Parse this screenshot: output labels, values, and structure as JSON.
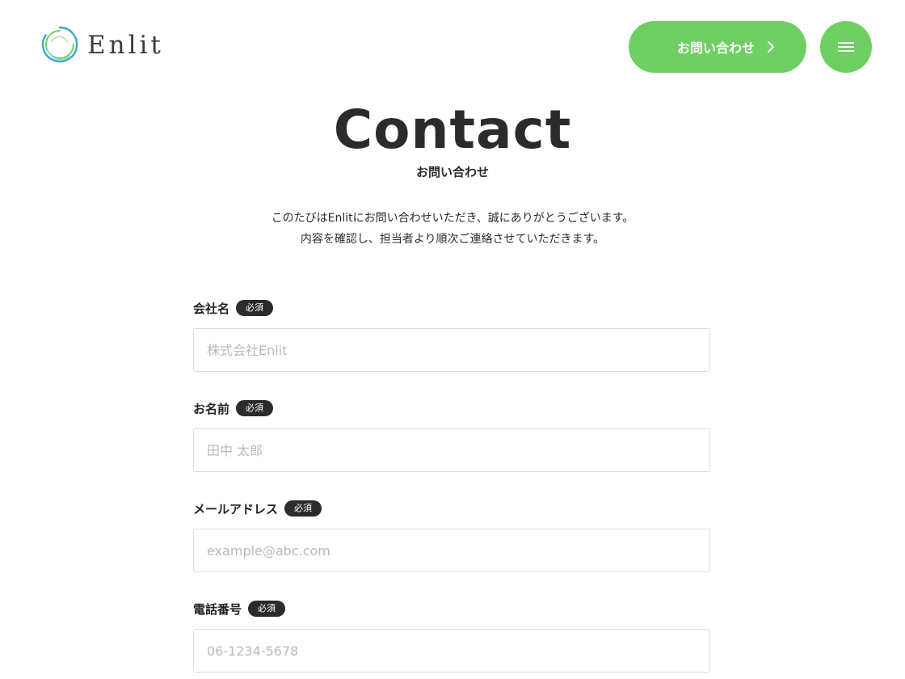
{
  "header": {
    "logo_text": "Enlit",
    "contact_button_label": "お問い合わせ"
  },
  "hero": {
    "title": "Contact",
    "subtitle": "お問い合わせ"
  },
  "intro": {
    "line1": "このたびはEnlitにお問い合わせいただき、誠にありがとうございます。",
    "line2": "内容を確認し、担当者より順次ご連絡させていただきます。"
  },
  "form": {
    "required_badge": "必須",
    "fields": [
      {
        "label": "会社名",
        "placeholder": "株式会社Enlit",
        "value": ""
      },
      {
        "label": "お名前",
        "placeholder": "田中 太郎",
        "value": ""
      },
      {
        "label": "メールアドレス",
        "placeholder": "example@abc.com",
        "value": ""
      },
      {
        "label": "電話番号",
        "placeholder": "06-1234-5678",
        "value": ""
      }
    ]
  },
  "colors": {
    "accent": "#6ecf62",
    "text": "#2b2b2b",
    "badge_bg": "#2b2b2b",
    "input_border": "#dcdcdc",
    "placeholder": "#b9b9b9"
  },
  "icons": {
    "logo": "circle-swirl-logo-icon",
    "contact_chevron": "chevron-right-icon",
    "menu": "hamburger-menu-icon"
  }
}
